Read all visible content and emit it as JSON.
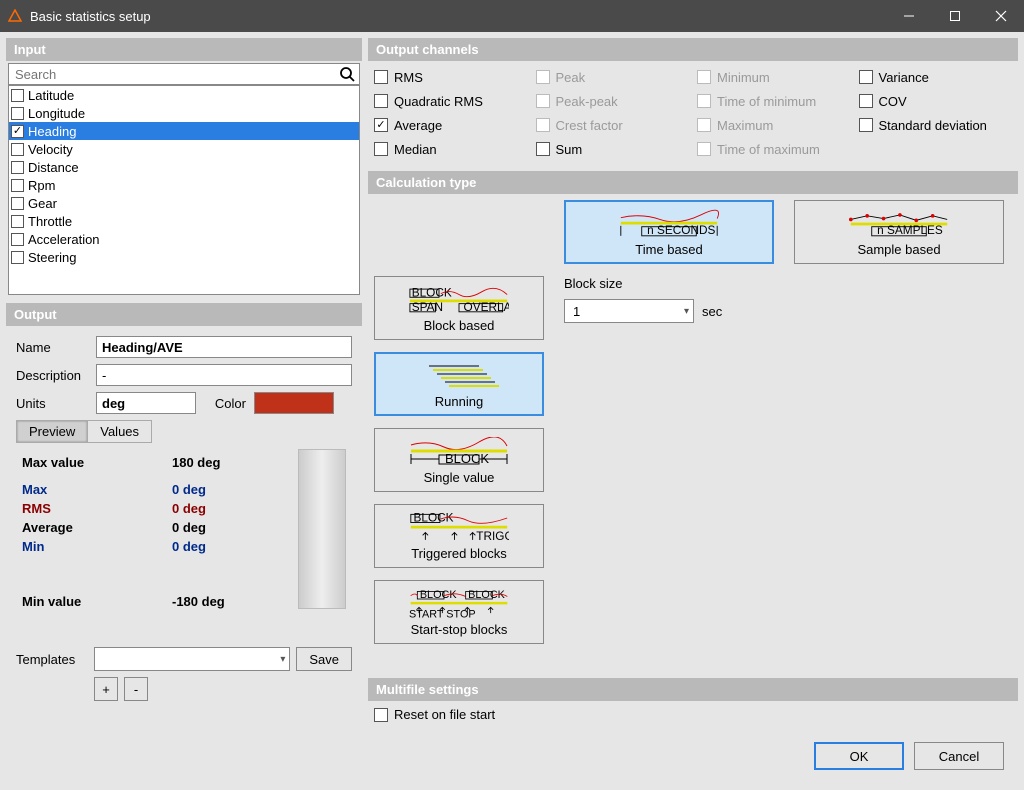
{
  "window": {
    "title": "Basic statistics setup"
  },
  "input": {
    "header": "Input",
    "search_placeholder": "Search",
    "channels": [
      {
        "name": "Latitude",
        "checked": false,
        "selected": false
      },
      {
        "name": "Longitude",
        "checked": false,
        "selected": false
      },
      {
        "name": "Heading",
        "checked": true,
        "selected": true
      },
      {
        "name": "Velocity",
        "checked": false,
        "selected": false
      },
      {
        "name": "Distance",
        "checked": false,
        "selected": false
      },
      {
        "name": "Rpm",
        "checked": false,
        "selected": false
      },
      {
        "name": "Gear",
        "checked": false,
        "selected": false
      },
      {
        "name": "Throttle",
        "checked": false,
        "selected": false
      },
      {
        "name": "Acceleration",
        "checked": false,
        "selected": false
      },
      {
        "name": "Steering",
        "checked": false,
        "selected": false
      }
    ]
  },
  "output": {
    "header": "Output",
    "name_label": "Name",
    "name_value": "Heading/AVE",
    "desc_label": "Description",
    "desc_value": "-",
    "units_label": "Units",
    "units_value": "deg",
    "color_label": "Color",
    "color_value": "#c0311a",
    "tabs": {
      "preview": "Preview",
      "values": "Values"
    },
    "preview": {
      "max_value_label": "Max value",
      "max_value": "180 deg",
      "max_label": "Max",
      "max": "0 deg",
      "rms_label": "RMS",
      "rms": "0 deg",
      "avg_label": "Average",
      "avg": "0 deg",
      "min_label": "Min",
      "min": "0 deg",
      "min_value_label": "Min value",
      "min_value": "-180 deg"
    },
    "templates_label": "Templates",
    "save_label": "Save",
    "add_label": "+",
    "remove_label": "-"
  },
  "out_channels": {
    "header": "Output channels",
    "items": [
      {
        "label": "RMS",
        "checked": false,
        "enabled": true
      },
      {
        "label": "Peak",
        "checked": false,
        "enabled": false
      },
      {
        "label": "Minimum",
        "checked": false,
        "enabled": false
      },
      {
        "label": "Variance",
        "checked": false,
        "enabled": true
      },
      {
        "label": "Quadratic RMS",
        "checked": false,
        "enabled": true
      },
      {
        "label": "Peak-peak",
        "checked": false,
        "enabled": false
      },
      {
        "label": "Time of minimum",
        "checked": false,
        "enabled": false
      },
      {
        "label": "COV",
        "checked": false,
        "enabled": true
      },
      {
        "label": "Average",
        "checked": true,
        "enabled": true
      },
      {
        "label": "Crest factor",
        "checked": false,
        "enabled": false
      },
      {
        "label": "Maximum",
        "checked": false,
        "enabled": false
      },
      {
        "label": "Standard deviation",
        "checked": false,
        "enabled": true
      },
      {
        "label": "Median",
        "checked": false,
        "enabled": true
      },
      {
        "label": "Sum",
        "checked": false,
        "enabled": true
      },
      {
        "label": "Time of maximum",
        "checked": false,
        "enabled": false
      }
    ]
  },
  "calc": {
    "header": "Calculation type",
    "time_based": "Time based",
    "sample_based": "Sample based",
    "block_based": "Block based",
    "running": "Running",
    "single_value": "Single value",
    "triggered": "Triggered blocks",
    "start_stop": "Start-stop blocks",
    "block_size_label": "Block size",
    "block_size_value": "1",
    "block_size_unit": "sec"
  },
  "multifile": {
    "header": "Multifile settings",
    "reset_label": "Reset on file start",
    "reset_checked": false
  },
  "footer": {
    "ok": "OK",
    "cancel": "Cancel"
  }
}
